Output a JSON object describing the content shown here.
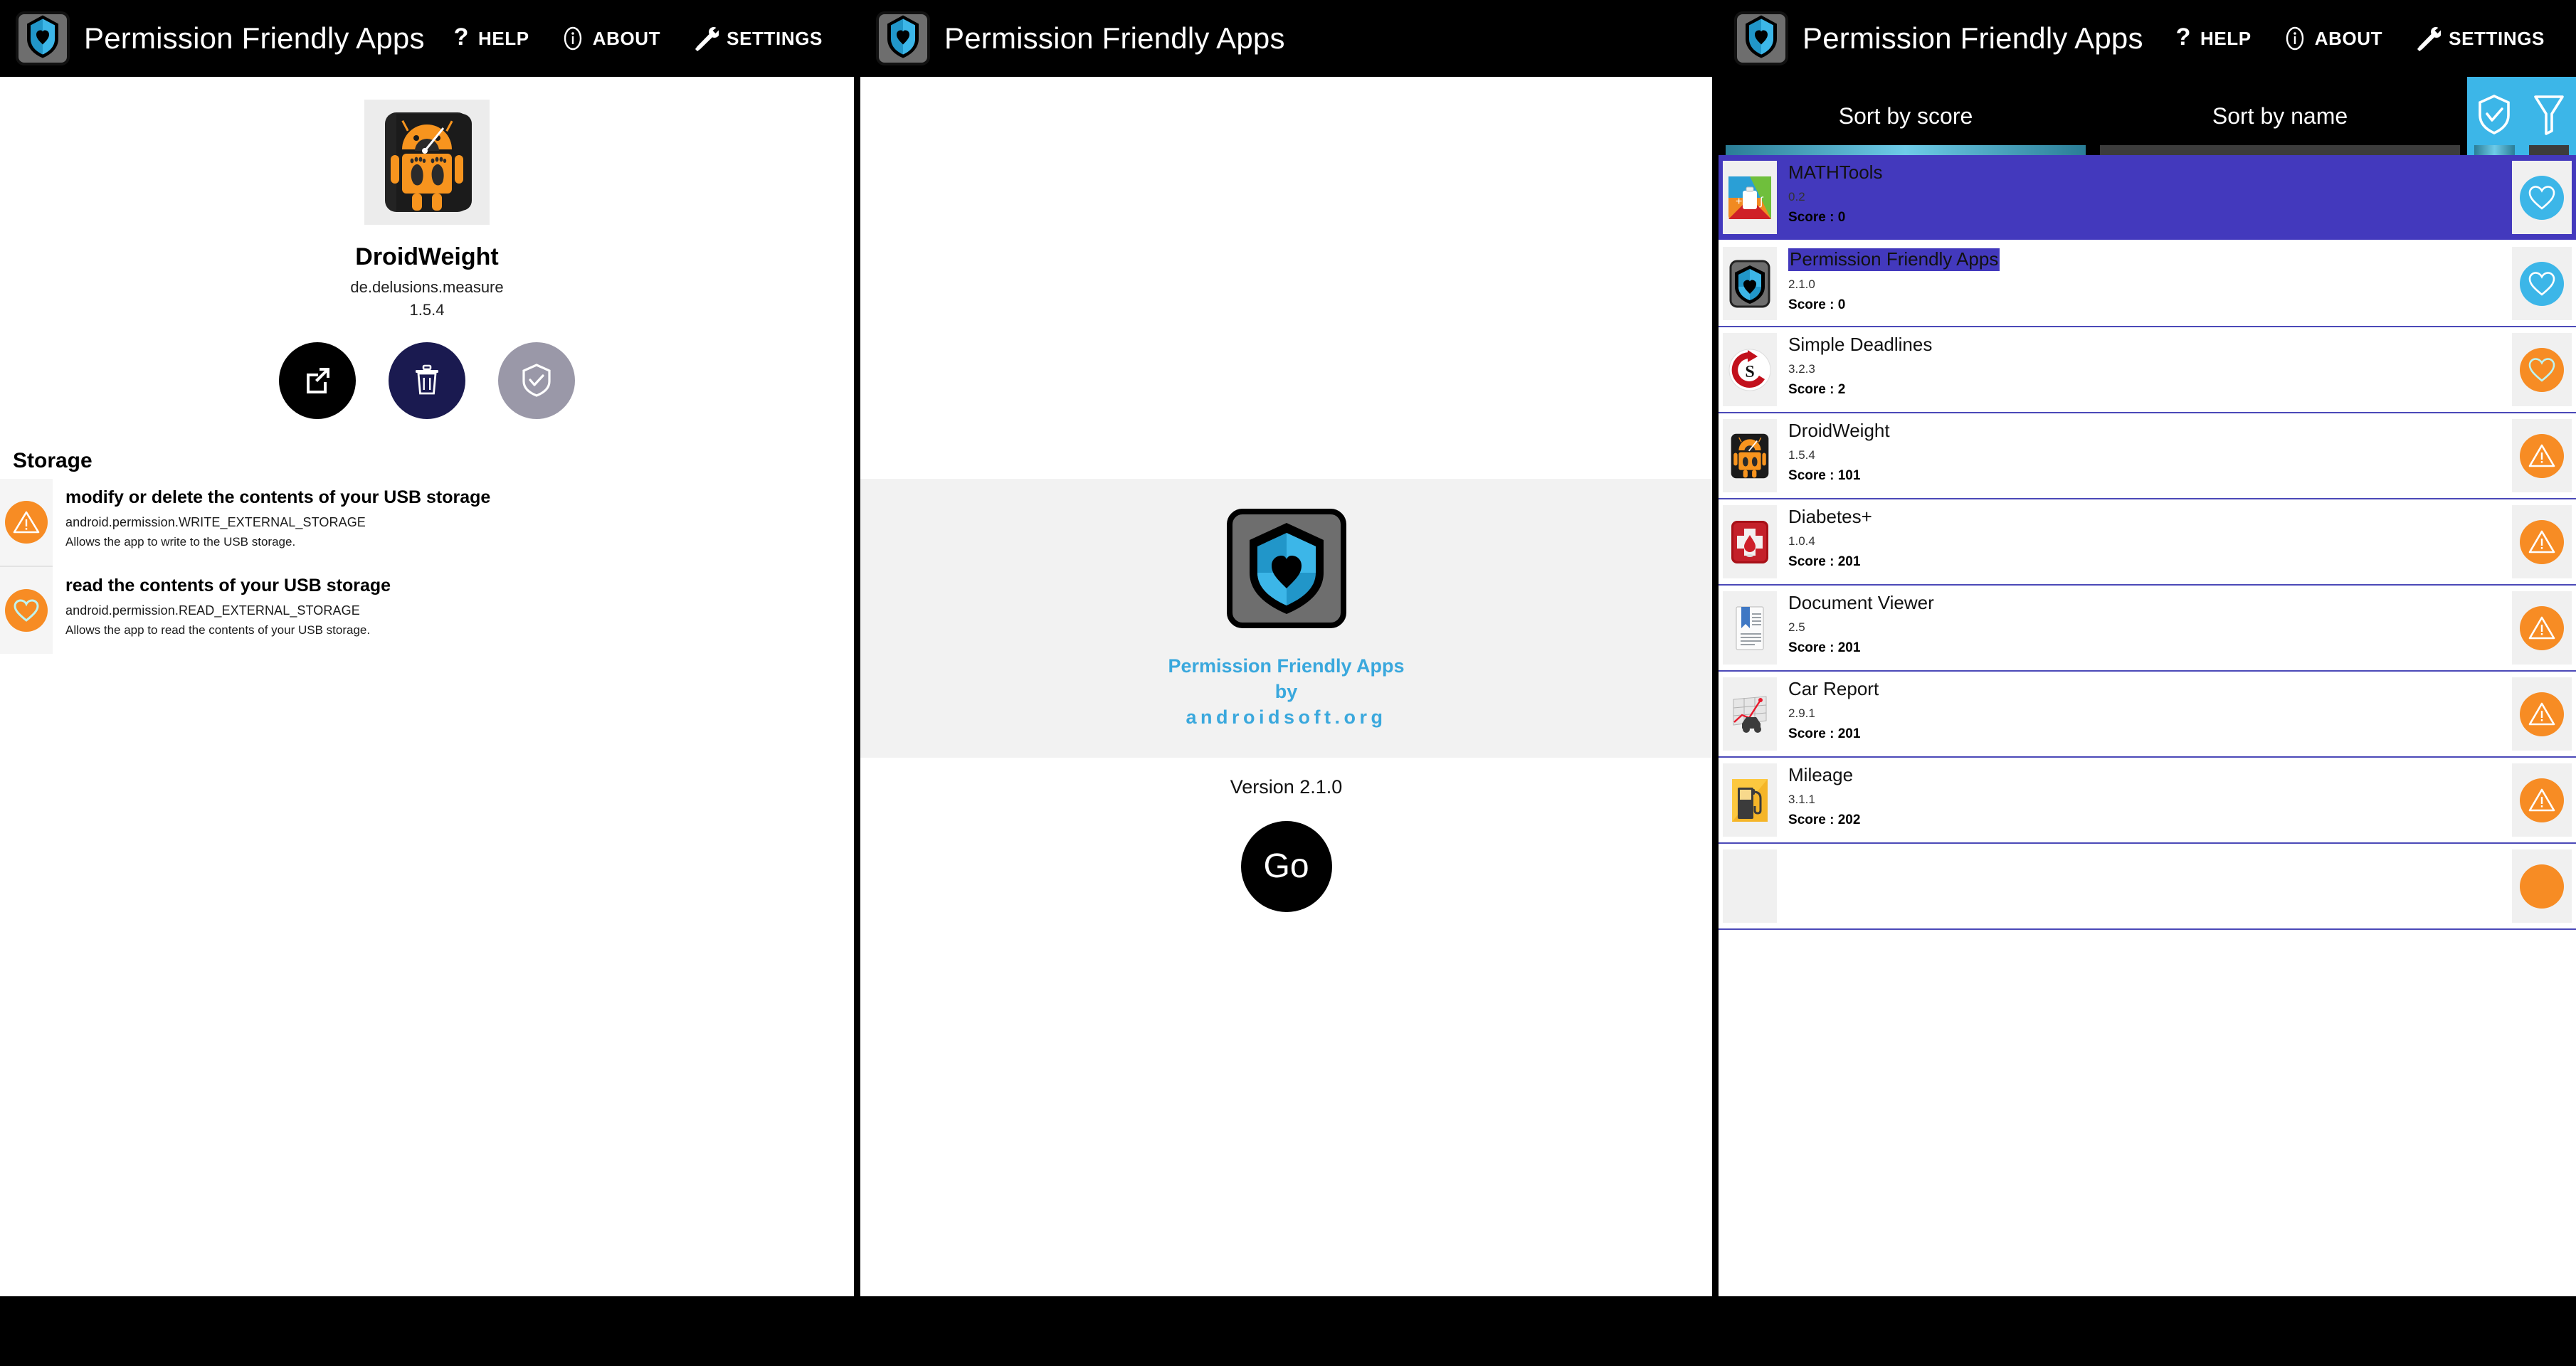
{
  "appbar": {
    "title": "Permission Friendly Apps",
    "logo_icon": "shield-heart-logo-icon",
    "actions": [
      {
        "label": "HELP",
        "icon": "question-mark-icon"
      },
      {
        "label": "ABOUT",
        "icon": "info-circle-icon"
      },
      {
        "label": "SETTINGS",
        "icon": "wrench-screwdriver-icon"
      }
    ]
  },
  "left_panel": {
    "app": {
      "icon": "droidweight-android-icon",
      "name": "DroidWeight",
      "package": "de.delusions.measure",
      "version": "1.5.4"
    },
    "actions": [
      {
        "name": "open-app-button",
        "icon": "open-external-icon"
      },
      {
        "name": "uninstall-button",
        "icon": "trash-icon"
      },
      {
        "name": "mark-safe-button",
        "icon": "shield-check-icon"
      }
    ],
    "permission_group": "Storage",
    "permissions": [
      {
        "icon": "warning-triangle-icon",
        "severity": "warn",
        "title": "modify or delete the contents of your USB storage",
        "constant": "android.permission.WRITE_EXTERNAL_STORAGE",
        "description": "Allows the app to write to the USB storage."
      },
      {
        "icon": "heart-icon",
        "severity": "warn",
        "title": "read the contents of your USB storage",
        "constant": "android.permission.READ_EXTERNAL_STORAGE",
        "description": "Allows the app to read the contents of your USB storage."
      }
    ]
  },
  "middle_panel": {
    "logo_icon": "shield-heart-logo-icon",
    "brand_line1": "Permission Friendly Apps",
    "brand_line2": "by",
    "brand_line3": "androidsoft.org",
    "version_label": "Version 2.1.0",
    "go_label": "Go"
  },
  "right_panel": {
    "tabs": [
      {
        "label": "Sort by score",
        "active": true
      },
      {
        "label": "Sort by name",
        "active": false
      }
    ],
    "icon_tabs": [
      {
        "icon": "shield-check-icon",
        "name": "tab-friendly-filter",
        "active": true
      },
      {
        "icon": "funnel-filter-icon",
        "name": "tab-filter",
        "active": false
      }
    ],
    "apps": [
      {
        "icon": "mathtools-icon",
        "name": "MATHTools",
        "version": "0.2",
        "score": "Score : 0",
        "badge": "heart-icon",
        "badge_severity": "ok",
        "selected": true,
        "name_highlight": false
      },
      {
        "icon": "shield-heart-logo-icon",
        "name": "Permission Friendly Apps",
        "version": "2.1.0",
        "score": "Score : 0",
        "badge": "heart-icon",
        "badge_severity": "ok",
        "selected": false,
        "name_highlight": true
      },
      {
        "icon": "simple-deadlines-icon",
        "name": "Simple Deadlines",
        "version": "3.2.3",
        "score": "Score : 2",
        "badge": "heart-icon",
        "badge_severity": "warn",
        "selected": false,
        "name_highlight": false
      },
      {
        "icon": "droidweight-android-icon",
        "name": "DroidWeight",
        "version": "1.5.4",
        "score": "Score : 101",
        "badge": "warning-triangle-icon",
        "badge_severity": "warn",
        "selected": false,
        "name_highlight": false
      },
      {
        "icon": "diabetes-icon",
        "name": "Diabetes+",
        "version": "1.0.4",
        "score": "Score : 201",
        "badge": "warning-triangle-icon",
        "badge_severity": "warn",
        "selected": false,
        "name_highlight": false
      },
      {
        "icon": "document-viewer-icon",
        "name": "Document Viewer",
        "version": "2.5",
        "score": "Score : 201",
        "badge": "warning-triangle-icon",
        "badge_severity": "warn",
        "selected": false,
        "name_highlight": false
      },
      {
        "icon": "car-report-icon",
        "name": "Car Report",
        "version": "2.9.1",
        "score": "Score : 201",
        "badge": "warning-triangle-icon",
        "badge_severity": "warn",
        "selected": false,
        "name_highlight": false
      },
      {
        "icon": "mileage-fuel-pump-icon",
        "name": "Mileage",
        "version": "3.1.1",
        "score": "Score : 202",
        "badge": "warning-triangle-icon",
        "badge_severity": "warn",
        "selected": false,
        "name_highlight": false
      }
    ]
  },
  "colors": {
    "accent_blue": "#3cb6e8",
    "selection_purple": "#4339bd",
    "warn_orange": "#f78c24",
    "appbar_black": "#000000"
  }
}
